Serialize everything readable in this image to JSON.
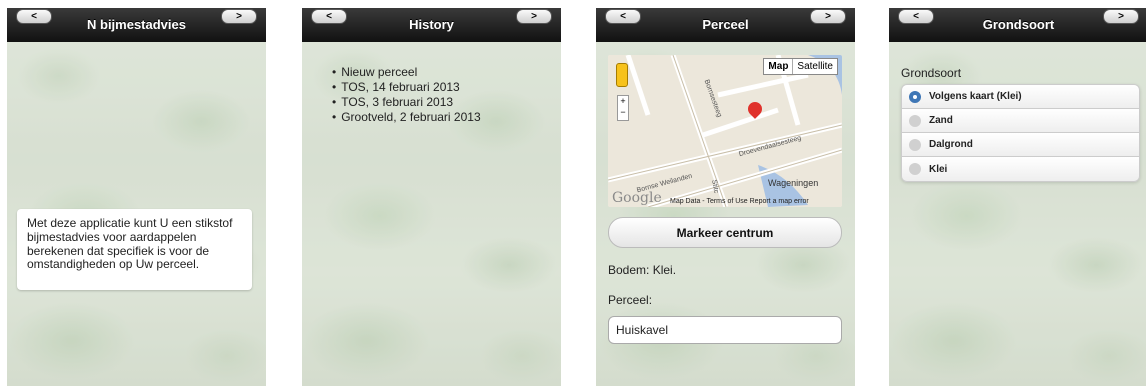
{
  "screens": [
    {
      "title": "N bijmestadvies",
      "info_text": "Met deze applicatie kunt U een stikstof bijmestadvies voor aardappelen berekenen dat specifiek is voor de omstandigheden op Uw perceel."
    },
    {
      "title": "History",
      "items": [
        "Nieuw perceel",
        "TOS, 14 februari 2013",
        "TOS, 3 februari 2013",
        "Grootveld, 2 februari 2013"
      ]
    },
    {
      "title": "Perceel",
      "map": {
        "type_buttons": [
          "Map",
          "Satellite"
        ],
        "zoom_in": "+",
        "zoom_out": "−",
        "streets": [
          "Bornsesteeg",
          "Droevendaalsesteeg",
          "Bornse Weilanden",
          "Wageningen",
          "Stitc"
        ],
        "logo": "Google",
        "attribution": "Map Data - Terms of Use  Report a map error"
      },
      "button": "Markeer centrum",
      "bodem": "Bodem: Klei.",
      "perceel_label": "Perceel:",
      "perceel_value": "Huiskavel"
    },
    {
      "title": "Grondsoort",
      "group_label": "Grondsoort",
      "options": [
        "Volgens kaart (Klei)",
        "Zand",
        "Dalgrond",
        "Klei"
      ],
      "selected": "Volgens kaart (Klei)"
    }
  ],
  "nav": {
    "back": "<",
    "forward": ">"
  },
  "colors": {
    "header": "#111111",
    "radio_selected": "#3f77b6",
    "marker": "#e0322c"
  }
}
